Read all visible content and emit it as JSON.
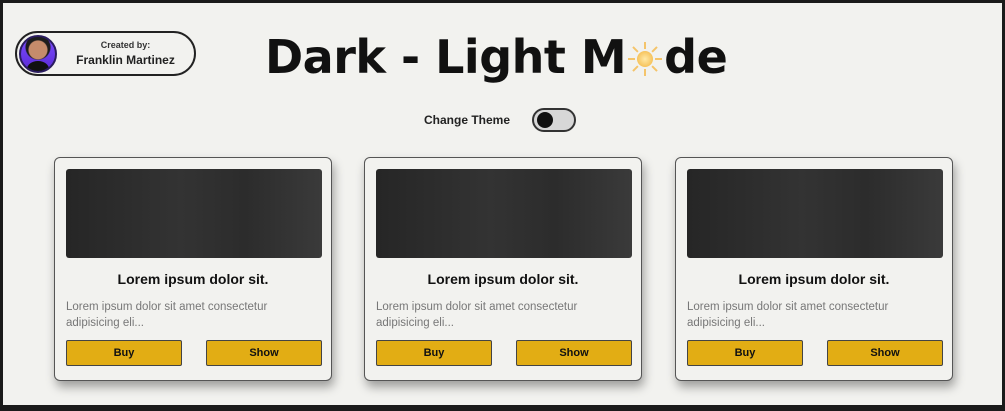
{
  "creator": {
    "label": "Created by:",
    "name": "Franklin Martinez"
  },
  "header": {
    "title_before": "Dark - Light M",
    "title_after": "de",
    "icon": "sun-icon"
  },
  "theme": {
    "label": "Change Theme",
    "toggle_state": "off"
  },
  "cards": [
    {
      "title": "Lorem ipsum dolor sit.",
      "description": "Lorem ipsum dolor sit amet consectetur adipisicing eli...",
      "buy_label": "Buy",
      "show_label": "Show"
    },
    {
      "title": "Lorem ipsum dolor sit.",
      "description": "Lorem ipsum dolor sit amet consectetur adipisicing eli...",
      "buy_label": "Buy",
      "show_label": "Show"
    },
    {
      "title": "Lorem ipsum dolor sit.",
      "description": "Lorem ipsum dolor sit amet consectetur adipisicing eli...",
      "buy_label": "Buy",
      "show_label": "Show"
    }
  ],
  "colors": {
    "background": "#f2f2ef",
    "accent": "#e2ad14",
    "text": "#111111"
  }
}
